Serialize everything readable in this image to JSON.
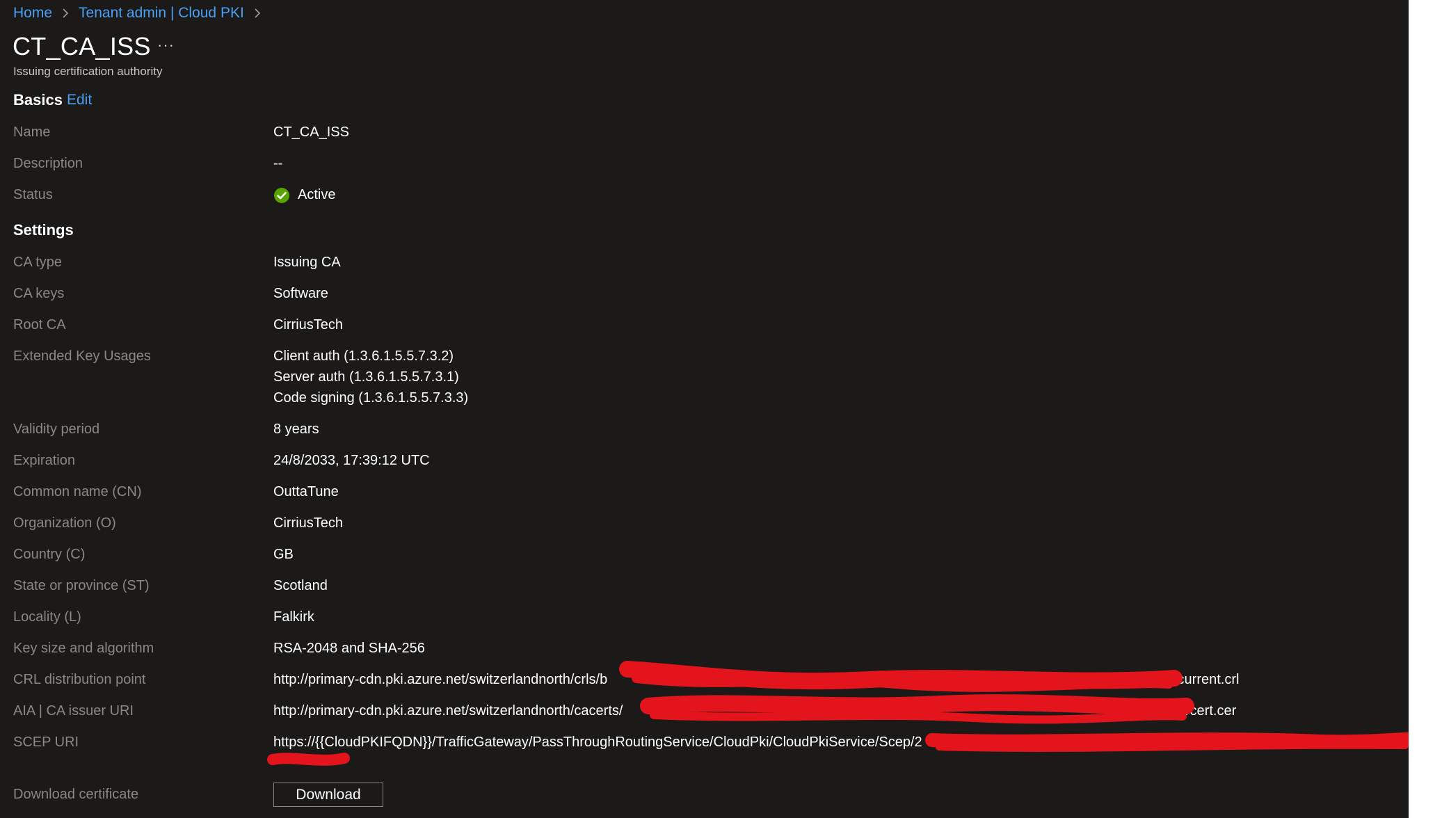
{
  "breadcrumb": {
    "home": "Home",
    "tenant": "Tenant admin | Cloud PKI"
  },
  "page": {
    "title": "CT_CA_ISS",
    "more_label": "···",
    "subtitle": "Issuing certification authority"
  },
  "basics": {
    "heading": "Basics",
    "edit_label": "Edit",
    "name_label": "Name",
    "name_value": "CT_CA_ISS",
    "description_label": "Description",
    "description_value": "--",
    "status_label": "Status",
    "status_value": "Active",
    "status_icon": "check-circle-icon",
    "status_color": "#57a300"
  },
  "settings": {
    "heading": "Settings",
    "ca_type_label": "CA type",
    "ca_type_value": "Issuing CA",
    "ca_keys_label": "CA keys",
    "ca_keys_value": "Software",
    "root_ca_label": "Root CA",
    "root_ca_value": "CirriusTech",
    "eku_label": "Extended Key Usages",
    "eku_values": [
      "Client auth (1.3.6.1.5.5.7.3.2)",
      "Server auth (1.3.6.1.5.5.7.3.1)",
      "Code signing (1.3.6.1.5.5.7.3.3)"
    ],
    "validity_label": "Validity period",
    "validity_value": "8 years",
    "expiration_label": "Expiration",
    "expiration_value": "24/8/2033, 17:39:12 UTC",
    "cn_label": "Common name (CN)",
    "cn_value": "OuttaTune",
    "org_label": "Organization (O)",
    "org_value": "CirriusTech",
    "country_label": "Country (C)",
    "country_value": "GB",
    "state_label": "State or province (ST)",
    "state_value": "Scotland",
    "locality_label": "Locality (L)",
    "locality_value": "Falkirk",
    "key_label": "Key size and algorithm",
    "key_value": "RSA-2048 and SHA-256",
    "crl_label": "CRL distribution point",
    "crl_value": "http://primary-cdn.pki.azure.net/switzerlandnorth/crls/b",
    "crl_suffix": "/current.crl",
    "aia_label": "AIA | CA issuer URI",
    "aia_value": "http://primary-cdn.pki.azure.net/switzerlandnorth/cacerts/",
    "aia_suffix": "/cert.cer",
    "scep_label": "SCEP URI",
    "scep_value": "https://{{CloudPKIFQDN}}/TrafficGateway/PassThroughRoutingService/CloudPki/CloudPkiService/Scep/2",
    "download_label": "Download certificate",
    "download_button": "Download"
  },
  "colors": {
    "background": "#1b1a19",
    "link": "#4aa0f5",
    "label": "#8a8886",
    "text": "#ffffff",
    "redaction": "#e3141b"
  }
}
